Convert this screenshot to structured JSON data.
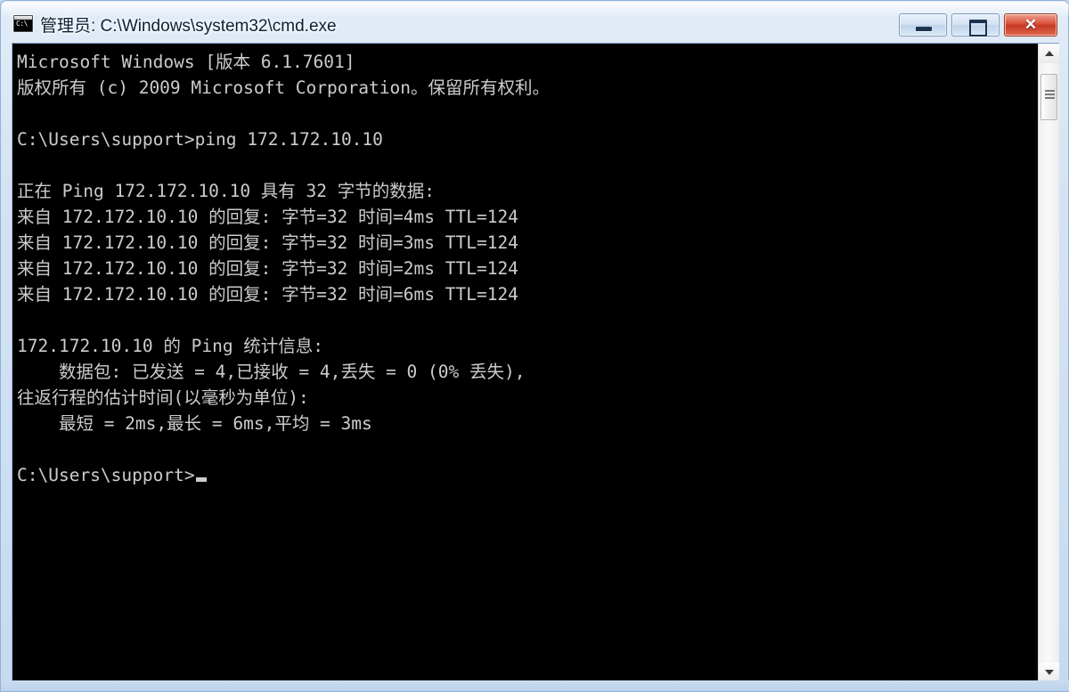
{
  "window": {
    "title": "管理员: C:\\Windows\\system32\\cmd.exe",
    "icon_glyph": "C:\\",
    "controls": {
      "minimize_label": "─",
      "maximize_label": "❐",
      "close_label": "✕"
    },
    "frame_color": "#d4e3f3",
    "accent_close_color": "#c53a22"
  },
  "console": {
    "background_color": "#000000",
    "text_color": "#cccccc",
    "lines": [
      "Microsoft Windows [版本 6.1.7601]",
      "版权所有 (c) 2009 Microsoft Corporation。保留所有权利。",
      "",
      "C:\\Users\\support>ping 172.172.10.10",
      "",
      "正在 Ping 172.172.10.10 具有 32 字节的数据:",
      "来自 172.172.10.10 的回复: 字节=32 时间=4ms TTL=124",
      "来自 172.172.10.10 的回复: 字节=32 时间=3ms TTL=124",
      "来自 172.172.10.10 的回复: 字节=32 时间=2ms TTL=124",
      "来自 172.172.10.10 的回复: 字节=32 时间=6ms TTL=124",
      "",
      "172.172.10.10 的 Ping 统计信息:",
      "    数据包: 已发送 = 4,已接收 = 4,丢失 = 0 (0% 丢失),",
      "往返行程的估计时间(以毫秒为单位):",
      "    最短 = 2ms,最长 = 6ms,平均 = 3ms",
      "",
      "C:\\Users\\support>"
    ],
    "prompt": "C:\\Users\\support>",
    "command": "ping 172.172.10.10",
    "target_host": "172.172.10.10",
    "payload_bytes": "32",
    "replies": [
      {
        "from": "172.172.10.10",
        "bytes": "32",
        "time": "4ms",
        "ttl": "124"
      },
      {
        "from": "172.172.10.10",
        "bytes": "32",
        "time": "3ms",
        "ttl": "124"
      },
      {
        "from": "172.172.10.10",
        "bytes": "32",
        "time": "2ms",
        "ttl": "124"
      },
      {
        "from": "172.172.10.10",
        "bytes": "32",
        "time": "6ms",
        "ttl": "124"
      }
    ],
    "statistics": {
      "sent": "4",
      "received": "4",
      "lost": "0",
      "lost_percent": "0%",
      "min": "2ms",
      "max": "6ms",
      "avg": "3ms"
    },
    "os_version": "6.1.7601",
    "copyright_year": "2009"
  },
  "scrollbar": {
    "up_arrow": "▲",
    "down_arrow": "▼"
  }
}
